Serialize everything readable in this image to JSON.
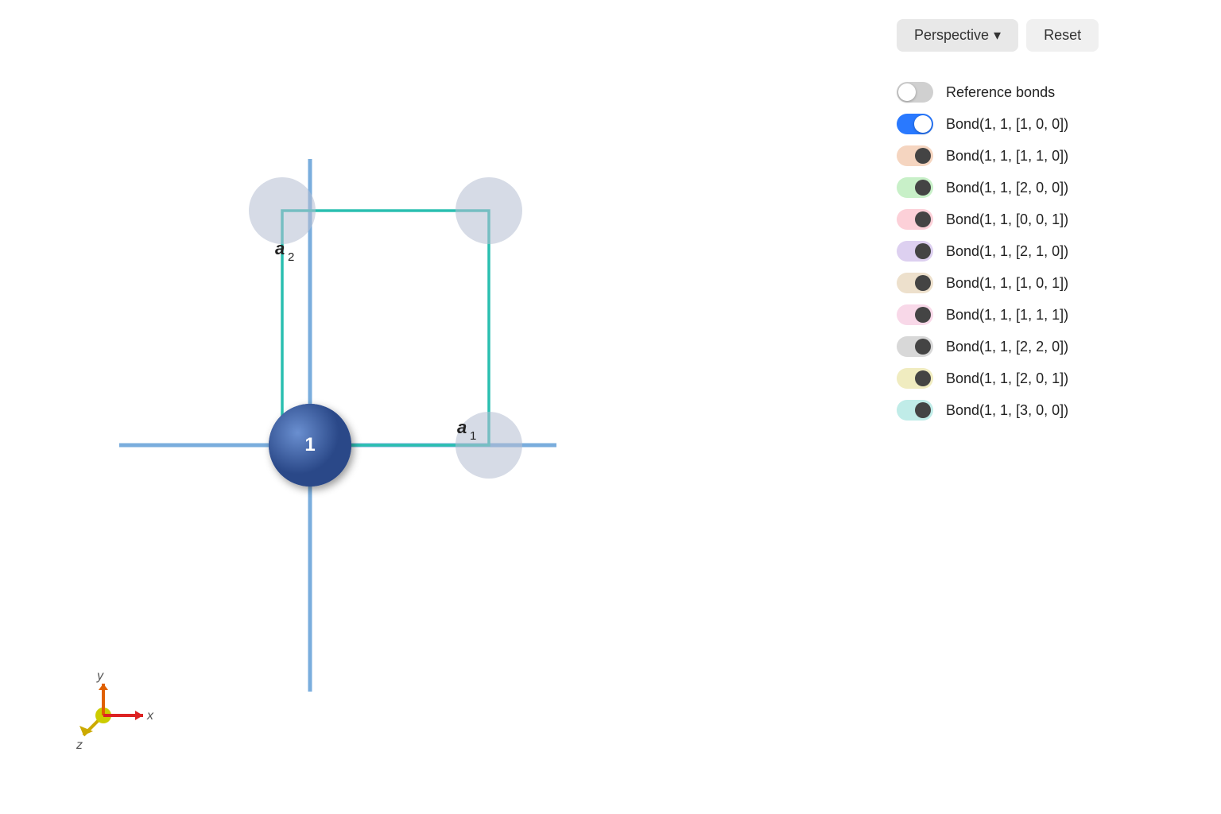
{
  "toolbar": {
    "perspective_label": "Perspective",
    "perspective_chevron": "▾",
    "reset_label": "Reset"
  },
  "legend": {
    "items": [
      {
        "id": "ref-bonds",
        "label": "Reference bonds",
        "type": "toggle",
        "state": "off",
        "color": "#cccccc"
      },
      {
        "id": "bond-1100",
        "label": "Bond(1, 1, [1, 0, 0])",
        "type": "toggle",
        "state": "on",
        "color": "#2979ff"
      },
      {
        "id": "bond-1110",
        "label": "Bond(1, 1, [1, 1, 0])",
        "type": "pill",
        "color": "#f5d5c0"
      },
      {
        "id": "bond-1200",
        "label": "Bond(1, 1, [2, 0, 0])",
        "type": "pill",
        "color": "#c8f0c8"
      },
      {
        "id": "bond-1001",
        "label": "Bond(1, 1, [0, 0, 1])",
        "type": "pill",
        "color": "#fcd0d8"
      },
      {
        "id": "bond-1210",
        "label": "Bond(1, 1, [2, 1, 0])",
        "type": "pill",
        "color": "#ddd0f0"
      },
      {
        "id": "bond-1101",
        "label": "Bond(1, 1, [1, 0, 1])",
        "type": "pill",
        "color": "#ede0cc"
      },
      {
        "id": "bond-1111",
        "label": "Bond(1, 1, [1, 1, 1])",
        "type": "pill",
        "color": "#f8d8e8"
      },
      {
        "id": "bond-1220",
        "label": "Bond(1, 1, [2, 2, 0])",
        "type": "pill",
        "color": "#d8d8d8"
      },
      {
        "id": "bond-1201",
        "label": "Bond(1, 1, [2, 0, 1])",
        "type": "pill",
        "color": "#f0ecc0"
      },
      {
        "id": "bond-1300",
        "label": "Bond(1, 1, [3, 0, 0])",
        "type": "pill",
        "color": "#c0ece8"
      }
    ]
  },
  "scene": {
    "atom_label": "1",
    "a1_label": "a₁",
    "a2_label": "a₂",
    "axis": {
      "x_label": "x",
      "y_label": "y",
      "z_label": "z"
    }
  }
}
